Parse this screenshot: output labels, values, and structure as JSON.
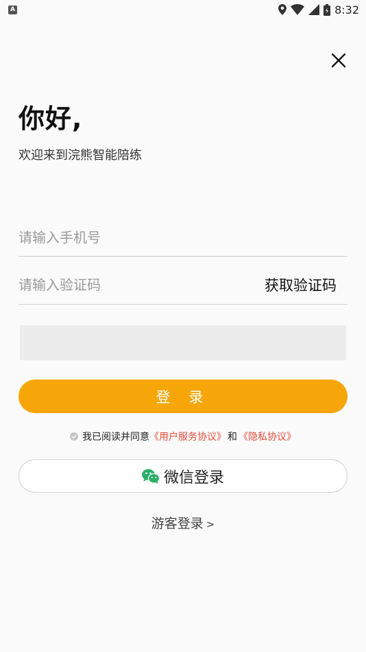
{
  "status_bar": {
    "left_icon_letter": "A",
    "time": "8:32",
    "icons": [
      "location-icon",
      "wifi-icon",
      "signal-icon",
      "battery-icon"
    ]
  },
  "header": {
    "close_icon": "close-icon"
  },
  "greeting": {
    "title": "你好,",
    "subtitle": "欢迎来到浣熊智能陪练"
  },
  "form": {
    "phone_placeholder": "请输入手机号",
    "code_placeholder": "请输入验证码",
    "get_code_label": "获取验证码",
    "login_label": "登 录"
  },
  "agreement": {
    "prefix": "我已阅读并同意",
    "user_agreement": "《用户服务协议》",
    "conjunction": "和",
    "privacy_policy": "《隐私协议》"
  },
  "wechat": {
    "label": "微信登录"
  },
  "guest": {
    "label": "游客登录",
    "arrow": ">"
  },
  "colors": {
    "accent": "#f6a609",
    "link": "#e44b3a",
    "wechat_green": "#2aae67",
    "background": "#fafafa"
  }
}
